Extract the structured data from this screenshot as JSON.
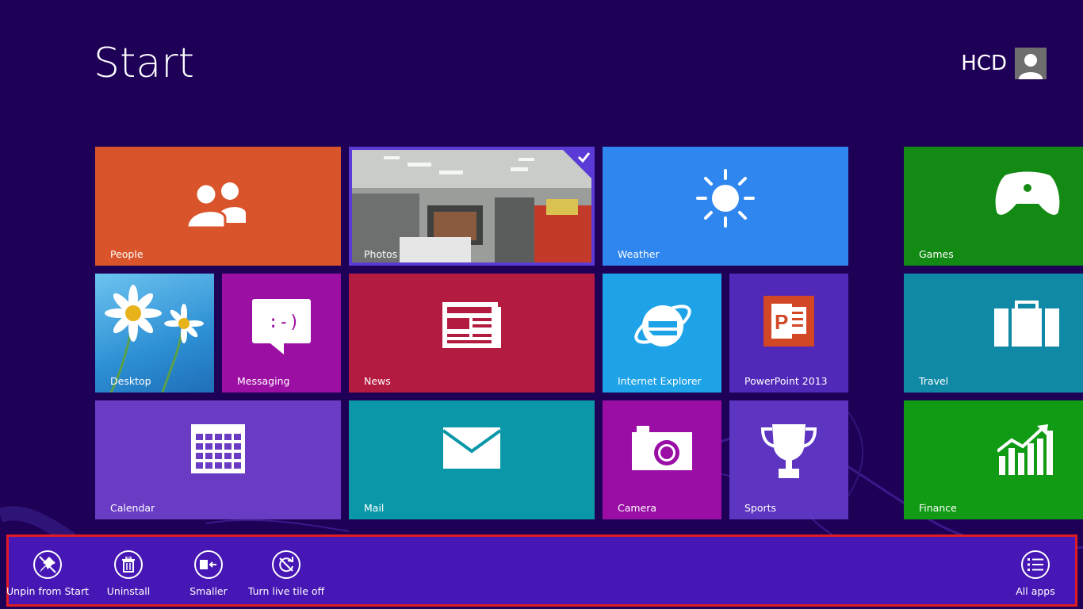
{
  "header": {
    "title": "Start",
    "user_name": "HCD"
  },
  "tiles": [
    {
      "label": "People",
      "color": "#d9542a"
    },
    {
      "label": "Photos",
      "color": "#3d1fa8",
      "selected": true
    },
    {
      "label": "Weather",
      "color": "#2f86ee"
    },
    {
      "label": "Games",
      "color": "#138a13"
    },
    {
      "label": "Desktop",
      "color": "#3aa0dc"
    },
    {
      "label": "Messaging",
      "color": "#9b0fa3"
    },
    {
      "label": "News",
      "color": "#b41b41"
    },
    {
      "label": "Internet Explorer",
      "color": "#1ea3e8"
    },
    {
      "label": "PowerPoint 2013",
      "color": "#5029b8"
    },
    {
      "label": "Travel",
      "color": "#1089a6"
    },
    {
      "label": "Calendar",
      "color": "#6a3cc4"
    },
    {
      "label": "Mail",
      "color": "#0a98a8"
    },
    {
      "label": "Camera",
      "color": "#9a0ea6"
    },
    {
      "label": "Sports",
      "color": "#5d35c0"
    },
    {
      "label": "Finance",
      "color": "#119a14"
    }
  ],
  "appbar": {
    "commands": [
      {
        "label": "Unpin from Start",
        "icon": "unpin-icon"
      },
      {
        "label": "Uninstall",
        "icon": "trash-icon"
      },
      {
        "label": "Smaller",
        "icon": "resize-smaller-icon"
      },
      {
        "label": "Turn live tile off",
        "icon": "live-tile-off-icon"
      }
    ],
    "all_apps": {
      "label": "All apps",
      "icon": "list-icon"
    }
  },
  "colors": {
    "background": "#1e0057",
    "appbar": "#4617b4",
    "appbar_border": "#e01b24"
  }
}
